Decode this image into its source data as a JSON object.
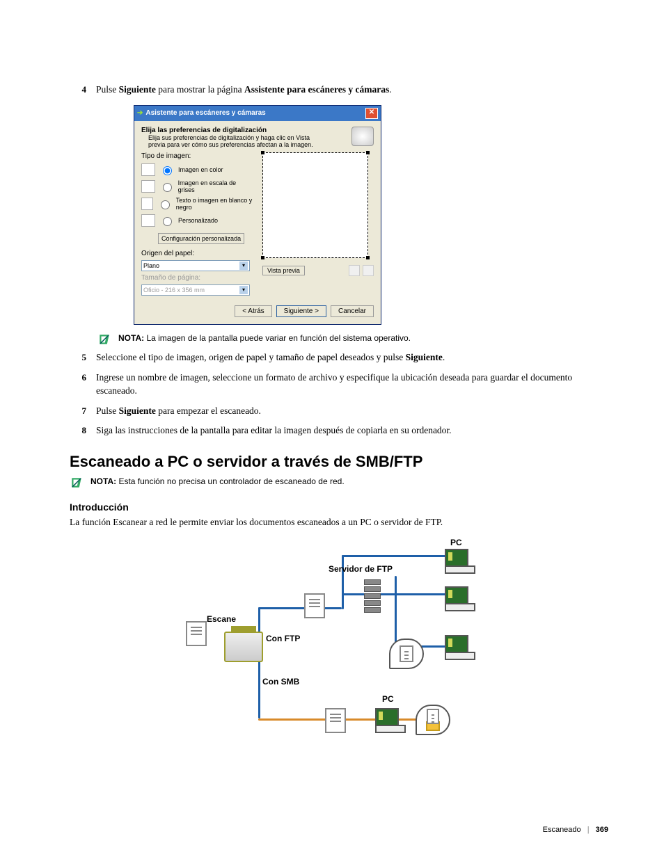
{
  "step4": {
    "num": "4",
    "pre": "Pulse ",
    "b1": "Siguiente",
    "mid": " para mostrar la página ",
    "b2": "Assistente para escáneres y cámaras",
    "post": "."
  },
  "window": {
    "title": "Asistente para escáneres y cámaras",
    "heading": "Elija las preferencias de digitalización",
    "subheading": "Elija sus preferencias de digitalización y haga clic en Vista previa para ver cómo sus preferencias afectan a la imagen.",
    "type_label": "Tipo de imagen:",
    "radios": {
      "r1": "Imagen en color",
      "r2": "Imagen en escala de grises",
      "r3": "Texto o imagen en blanco y negro",
      "r4": "Personalizado"
    },
    "config_btn": "Configuración personalizada",
    "origin_label": "Origen del papel:",
    "origin_value": "Plano",
    "size_label": "Tamaño de página:",
    "size_value": "Oficio - 216 x 356 mm",
    "preview_btn": "Vista previa",
    "back": "< Atrás",
    "next": "Siguiente >",
    "cancel": "Cancelar"
  },
  "note1": {
    "bold": "NOTA:",
    "text": " La imagen de la pantalla puede variar en función del sistema operativo."
  },
  "step5": {
    "num": "5",
    "pre": "Seleccione el tipo de imagen, origen de papel y tamaño de papel deseados y pulse ",
    "b1": "Siguiente",
    "post": "."
  },
  "step6": {
    "num": "6",
    "text": "Ingrese un nombre de imagen, seleccione un formato de archivo y especifique la ubicación deseada para guardar el documento escaneado."
  },
  "step7": {
    "num": "7",
    "pre": "Pulse ",
    "b1": "Siguiente",
    "post": " para empezar el escaneado."
  },
  "step8": {
    "num": "8",
    "text": "Siga las instrucciones de la pantalla para editar la imagen después de copiarla en su ordenador."
  },
  "section_title": "Escaneado a PC o servidor a través de SMB/FTP",
  "note2": {
    "bold": "NOTA:",
    "text": " Esta función no precisa un controlador de escaneado de red."
  },
  "intro_heading": "Introducción",
  "intro_body": "La función Escanear a red le permite enviar los documentos escaneados a un PC o servidor de FTP.",
  "diagram": {
    "pc1": "PC",
    "ftp": "Servidor de FTP",
    "escane": "Escane",
    "conftp": "Con FTP",
    "consmb": "Con SMB",
    "pc2": "PC"
  },
  "footer": {
    "section": "Escaneado",
    "page": "369"
  }
}
